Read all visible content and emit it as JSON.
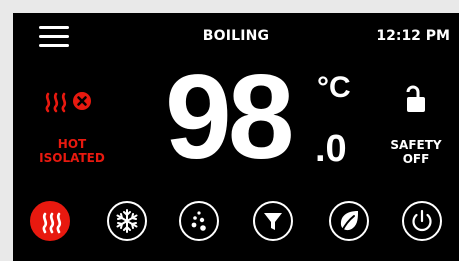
{
  "header": {
    "menu_icon": "hamburger-menu-icon",
    "mode_title": "BOILING",
    "time": "12:12 PM"
  },
  "temperature": {
    "whole": "98",
    "fraction": ".0",
    "unit": "°C"
  },
  "heat_status": {
    "icons": [
      "heat-waves-icon",
      "x-circle-icon"
    ],
    "label_line1": "HOT",
    "label_line2": "ISOLATED",
    "color": "#e8190f"
  },
  "safety_status": {
    "icon": "unlocked-padlock-icon",
    "label_line1": "SAFETY",
    "label_line2": "OFF"
  },
  "mode_buttons": [
    {
      "id": "boiling",
      "icon": "heat-waves-icon",
      "active": true
    },
    {
      "id": "chilled",
      "icon": "snowflake-icon",
      "active": false
    },
    {
      "id": "sparkling",
      "icon": "bubbles-icon",
      "active": false
    },
    {
      "id": "filter",
      "icon": "funnel-icon",
      "active": false
    },
    {
      "id": "eco",
      "icon": "leaf-icon",
      "active": false
    },
    {
      "id": "power",
      "icon": "power-icon",
      "active": false
    }
  ],
  "colors": {
    "background": "#000000",
    "accent": "#e8190f",
    "frame": "#e9e9e9"
  }
}
